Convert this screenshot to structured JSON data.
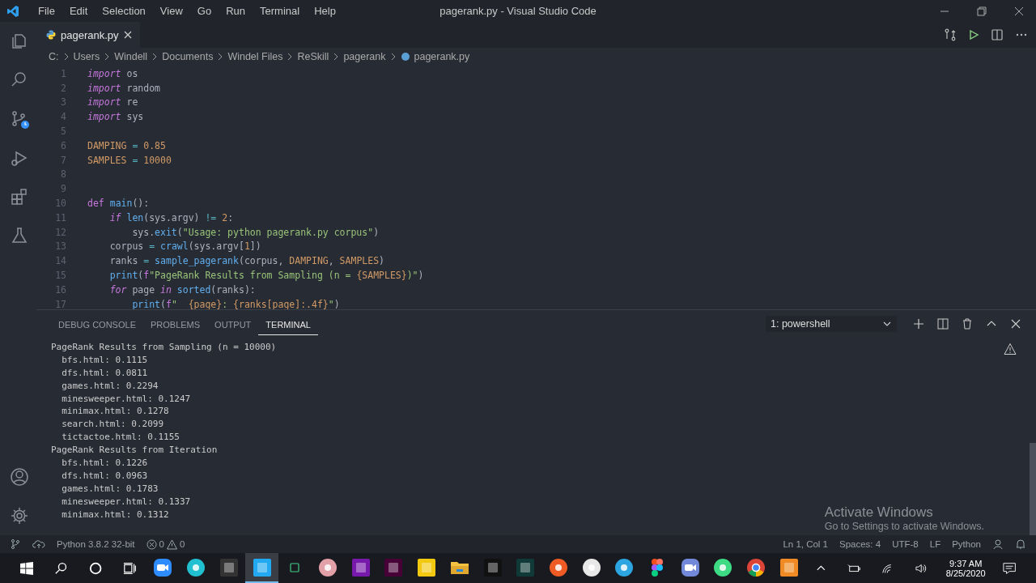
{
  "window": {
    "title": "pagerank.py - Visual Studio Code"
  },
  "menu": [
    "File",
    "Edit",
    "Selection",
    "View",
    "Go",
    "Run",
    "Terminal",
    "Help"
  ],
  "activity_bar": {
    "top": [
      {
        "kind": "files",
        "selected": false
      },
      {
        "kind": "search",
        "selected": false
      },
      {
        "kind": "source-control",
        "selected": false
      },
      {
        "kind": "debug",
        "selected": false
      },
      {
        "kind": "extensions",
        "selected": false
      },
      {
        "kind": "testing",
        "selected": false
      }
    ],
    "bottom": [
      {
        "kind": "account"
      },
      {
        "kind": "settings"
      }
    ]
  },
  "tabs": [
    {
      "label": "pagerank.py",
      "selected": true
    }
  ],
  "breadcrumb": [
    "C:",
    "Users",
    "Windell",
    "Documents",
    "Windel Files",
    "ReSkill",
    "pagerank",
    "pagerank.py"
  ],
  "editor": {
    "lines": [
      {
        "number": "1",
        "tokens": [
          {
            "kind": "keyword",
            "text": "import"
          },
          {
            "kind": "plain",
            "text": " os"
          }
        ]
      },
      {
        "number": "2",
        "tokens": [
          {
            "kind": "keyword",
            "text": "import"
          },
          {
            "kind": "plain",
            "text": " random"
          }
        ]
      },
      {
        "number": "3",
        "tokens": [
          {
            "kind": "keyword",
            "text": "import"
          },
          {
            "kind": "plain",
            "text": " re"
          }
        ]
      },
      {
        "number": "4",
        "tokens": [
          {
            "kind": "keyword",
            "text": "import"
          },
          {
            "kind": "plain",
            "text": " sys"
          }
        ]
      },
      {
        "number": "5"
      },
      {
        "number": "6",
        "tokens": [
          {
            "kind": "constant",
            "text": "DAMPING"
          },
          {
            "kind": "operator",
            "text": " = "
          },
          {
            "kind": "number",
            "text": "0.85"
          }
        ]
      },
      {
        "number": "7",
        "tokens": [
          {
            "kind": "constant",
            "text": "SAMPLES"
          },
          {
            "kind": "operator",
            "text": " = "
          },
          {
            "kind": "number",
            "text": "10000"
          }
        ]
      },
      {
        "number": "8"
      },
      {
        "number": "9"
      },
      {
        "number": "10",
        "tokens": [
          {
            "kind": "keyword2",
            "text": "def"
          },
          {
            "kind": "function",
            "text": " main"
          },
          {
            "kind": "plain",
            "text": "():"
          }
        ]
      },
      {
        "number": "11",
        "tokens": [
          {
            "kind": "keyword",
            "text": "    if"
          },
          {
            "kind": "function",
            "text": " len"
          },
          {
            "kind": "plain",
            "text": "(sys.argv) "
          },
          {
            "kind": "operator",
            "text": "!="
          },
          {
            "kind": "number",
            "text": " 2"
          },
          {
            "kind": "plain",
            "text": ":"
          }
        ]
      },
      {
        "number": "12",
        "tokens": [
          {
            "kind": "plain",
            "text": "        sys."
          },
          {
            "kind": "function",
            "text": "exit"
          },
          {
            "kind": "plain",
            "text": "("
          },
          {
            "kind": "string",
            "text": "\"Usage: python pagerank.py corpus\""
          },
          {
            "kind": "plain",
            "text": ")"
          }
        ]
      },
      {
        "number": "13",
        "tokens": [
          {
            "kind": "plain",
            "text": "    corpus "
          },
          {
            "kind": "operator",
            "text": "="
          },
          {
            "kind": "function",
            "text": " crawl"
          },
          {
            "kind": "plain",
            "text": "(sys.argv["
          },
          {
            "kind": "number",
            "text": "1"
          },
          {
            "kind": "plain",
            "text": "])"
          }
        ]
      },
      {
        "number": "14",
        "tokens": [
          {
            "kind": "plain",
            "text": "    ranks "
          },
          {
            "kind": "operator",
            "text": "="
          },
          {
            "kind": "function",
            "text": " sample_pagerank"
          },
          {
            "kind": "plain",
            "text": "(corpus, "
          },
          {
            "kind": "constant",
            "text": "DAMPING"
          },
          {
            "kind": "plain",
            "text": ", "
          },
          {
            "kind": "constant",
            "text": "SAMPLES"
          },
          {
            "kind": "plain",
            "text": ")"
          }
        ]
      },
      {
        "number": "15",
        "tokens": [
          {
            "kind": "function",
            "text": "    print"
          },
          {
            "kind": "plain",
            "text": "("
          },
          {
            "kind": "keyword2",
            "text": "f"
          },
          {
            "kind": "string",
            "text": "\"PageRank Results from Sampling (n = "
          },
          {
            "kind": "constant",
            "text": "{SAMPLES}"
          },
          {
            "kind": "string",
            "text": ")\""
          },
          {
            "kind": "plain",
            "text": ")"
          }
        ]
      },
      {
        "number": "16",
        "tokens": [
          {
            "kind": "keyword",
            "text": "    for"
          },
          {
            "kind": "plain",
            "text": " page "
          },
          {
            "kind": "keyword",
            "text": "in"
          },
          {
            "kind": "function",
            "text": " sorted"
          },
          {
            "kind": "plain",
            "text": "(ranks):"
          }
        ]
      },
      {
        "number": "17",
        "tokens": [
          {
            "kind": "function",
            "text": "        print"
          },
          {
            "kind": "plain",
            "text": "("
          },
          {
            "kind": "keyword2",
            "text": "f"
          },
          {
            "kind": "string",
            "text": "\"  "
          },
          {
            "kind": "constant",
            "text": "{page}"
          },
          {
            "kind": "string",
            "text": ": "
          },
          {
            "kind": "constant",
            "text": "{ranks[page]:.4f}"
          },
          {
            "kind": "string",
            "text": "\""
          },
          {
            "kind": "plain",
            "text": ")"
          }
        ]
      }
    ]
  },
  "panel": {
    "tabs": [
      {
        "label": "DEBUG CONSOLE",
        "selected": false
      },
      {
        "label": "PROBLEMS",
        "selected": false
      },
      {
        "label": "OUTPUT",
        "selected": false
      },
      {
        "label": "TERMINAL",
        "selected": true
      }
    ],
    "terminal_select": "1: powershell",
    "terminal_lines": [
      "PageRank Results from Sampling (n = 10000)",
      "  bfs.html: 0.1115",
      "  dfs.html: 0.0811",
      "  games.html: 0.2294",
      "  minesweeper.html: 0.1247",
      "  minimax.html: 0.1278",
      "  search.html: 0.2099",
      "  tictactoe.html: 0.1155",
      "PageRank Results from Iteration",
      "  bfs.html: 0.1226",
      "  dfs.html: 0.0963",
      "  games.html: 0.1783",
      "  minesweeper.html: 0.1337",
      "  minimax.html: 0.1312"
    ]
  },
  "activation_notice": {
    "title": "Activate Windows",
    "message": "Go to Settings to activate Windows."
  },
  "status_bar": {
    "interpreter": "Python 3.8.2 32-bit",
    "errors": "0",
    "warnings": "0",
    "position": "Ln 1, Col 1",
    "indent": "Spaces: 4",
    "encoding": "UTF-8",
    "eol": "LF",
    "language": "Python"
  },
  "taskbar": {
    "apps": [
      {
        "kind": "zoom",
        "selected": false
      },
      {
        "kind": "picsart",
        "selected": false
      },
      {
        "kind": "game",
        "selected": false
      },
      {
        "kind": "vscode",
        "selected": true
      },
      {
        "kind": "small",
        "selected": false
      },
      {
        "kind": "snip",
        "selected": false
      },
      {
        "kind": "onenote",
        "selected": false
      },
      {
        "kind": "xd",
        "selected": false
      },
      {
        "kind": "powerbi",
        "selected": false
      },
      {
        "kind": "folder",
        "selected": false
      },
      {
        "kind": "cmd",
        "selected": false
      },
      {
        "kind": "hashnode",
        "selected": false
      },
      {
        "kind": "postman",
        "selected": false
      },
      {
        "kind": "slack",
        "selected": false
      },
      {
        "kind": "telegram",
        "selected": false
      },
      {
        "kind": "figma",
        "selected": false
      },
      {
        "kind": "discord",
        "selected": false
      },
      {
        "kind": "android",
        "selected": false
      },
      {
        "kind": "chrome",
        "selected": false
      },
      {
        "kind": "recorder",
        "selected": false
      }
    ],
    "time": "9:37 AM",
    "date": "8/25/2020"
  }
}
